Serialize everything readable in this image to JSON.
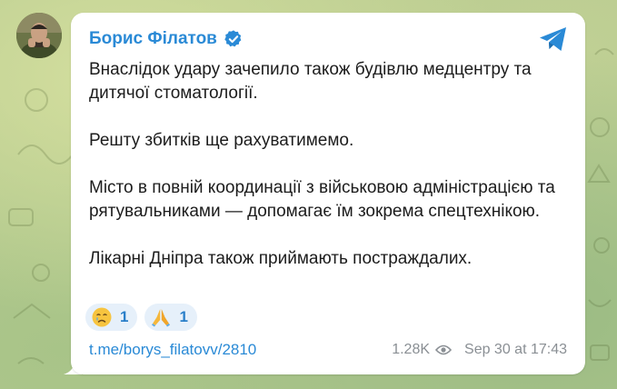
{
  "channel": {
    "name": "Борис Філатов",
    "verified_icon": "verified-badge-icon",
    "share_icon": "telegram-send-icon",
    "accent_color": "#2a8ad6"
  },
  "post": {
    "paragraphs": [
      "Внаслідок удару зачепило також будівлю медцентру та дитячої стоматології.",
      "Решту збитків ще рахуватимемо.",
      "Місто в повній координації з військовою адміністрацією та рятувальниками — допомагає їм зокрема спецтехнікою.",
      "Лікарні Дніпра також приймають постраждалих."
    ],
    "reactions": [
      {
        "emoji_icon": "crying-face-icon",
        "count": "1"
      },
      {
        "emoji_icon": "folded-hands-icon",
        "count": "1"
      }
    ],
    "link": "t.me/borys_filatovv/2810",
    "views": "1.28K",
    "views_icon": "eye-icon",
    "timestamp": "Sep 30 at 17:43"
  }
}
